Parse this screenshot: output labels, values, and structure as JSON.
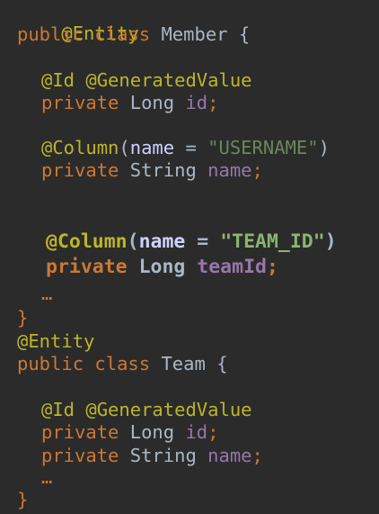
{
  "entity_annotation": "@Entity",
  "id_annotations": "@Id @GeneratedValue",
  "column_annotation": "@Column",
  "kw_public": "public",
  "kw_class": "class",
  "kw_private": "private",
  "type_long": "Long",
  "type_string": "String",
  "param_name": "name",
  "equals": " = ",
  "open_paren": "(",
  "close_paren": ")",
  "semicolon": ";",
  "open_brace": "{",
  "close_brace": "}",
  "ellipsis": "…",
  "member": {
    "class_name": "Member",
    "id_field": "id",
    "name_field": "name",
    "username_column": "\"USERNAME\"",
    "team_column": "\"TEAM_ID\"",
    "team_field": "teamId"
  },
  "team": {
    "class_name": "Team",
    "id_field": "id",
    "name_field": "name"
  }
}
